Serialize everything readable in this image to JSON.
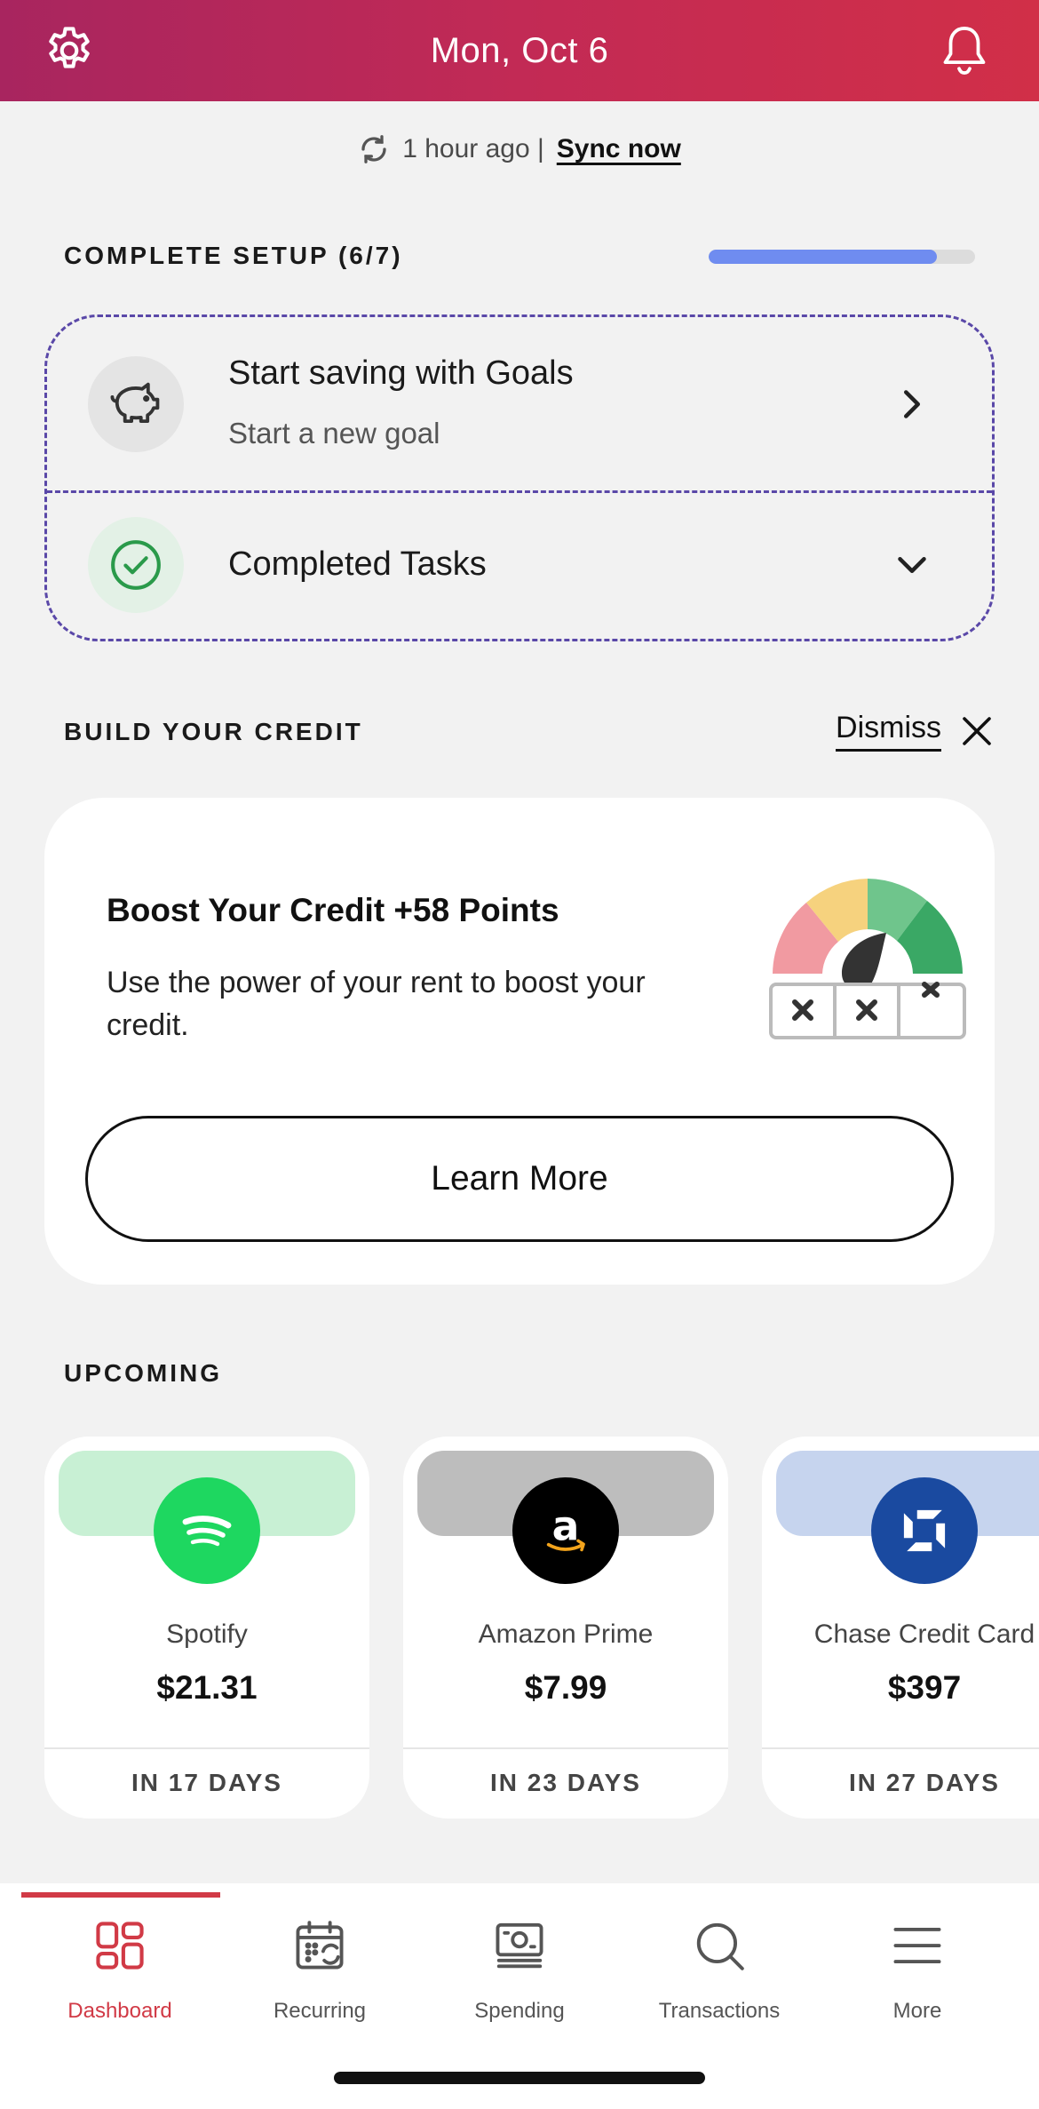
{
  "header": {
    "title": "Mon, Oct 6",
    "left_icon": "gear-icon",
    "right_icon": "bell-icon"
  },
  "sync": {
    "status": "1 hour ago |",
    "link": "Sync now",
    "icon": "refresh-icon"
  },
  "setup": {
    "title": "COMPLETE SETUP (6/7)",
    "progress": 0.857,
    "items": [
      {
        "title": "Start saving with Goals",
        "subtitle": "Start a new goal",
        "icon": "piggy-bank-icon"
      },
      {
        "title": "Completed Tasks",
        "icon": "check-circle-icon"
      }
    ]
  },
  "credit": {
    "section_title": "BUILD YOUR CREDIT",
    "dismiss": "Dismiss",
    "card_title": "Boost Your Credit +58 Points",
    "card_desc": "Use the power of your rent to boost your credit.",
    "button": "Learn More"
  },
  "upcoming": {
    "title": "UPCOMING",
    "bills": [
      {
        "name": "Spotify",
        "amount": "$21.31",
        "due": "IN 17 DAYS",
        "band_color": "#c8f0d4",
        "logo_color": "#1ed760"
      },
      {
        "name": "Amazon Prime",
        "amount": "$7.99",
        "due": "IN 23 DAYS",
        "band_color": "#bdbdbd",
        "logo_color": "#000000"
      },
      {
        "name": "Chase Credit Card",
        "amount": "$397",
        "due": "IN 27 DAYS",
        "band_color": "#c6d4ee",
        "logo_color": "#1a4aa0"
      }
    ]
  },
  "tabs": [
    {
      "label": "Dashboard",
      "icon": "dashboard-icon",
      "active": true
    },
    {
      "label": "Recurring",
      "icon": "calendar-icon",
      "active": false
    },
    {
      "label": "Spending",
      "icon": "money-icon",
      "active": false
    },
    {
      "label": "Transactions",
      "icon": "search-icon",
      "active": false
    },
    {
      "label": "More",
      "icon": "menu-icon",
      "active": false
    }
  ],
  "colors": {
    "accent": "#d13a46",
    "progress": "#6f8cf0",
    "dashed": "#5a48a8"
  }
}
